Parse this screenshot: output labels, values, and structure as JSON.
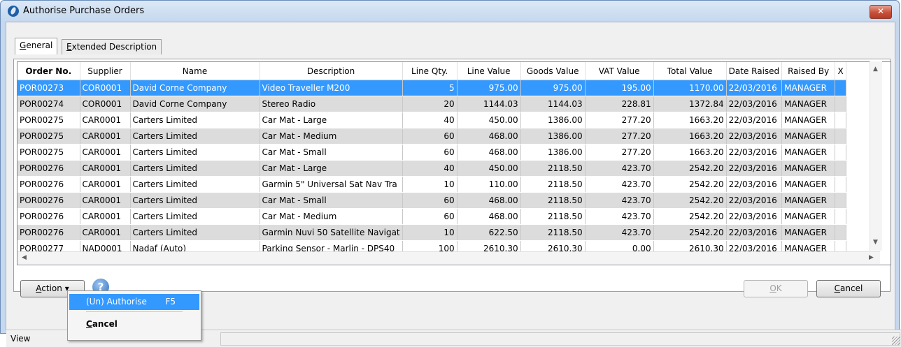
{
  "window": {
    "title": "Authorise Purchase Orders",
    "close_glyph": "✕"
  },
  "tabs": [
    {
      "label": "General",
      "mnemonic": "G",
      "rest": "eneral"
    },
    {
      "label": "Extended Description",
      "mnemonic": "E",
      "rest": "xtended Description"
    }
  ],
  "columns": [
    "Order No.",
    "Supplier",
    "Name",
    "Description",
    "Line Qty.",
    "Line Value",
    "Goods Value",
    "VAT Value",
    "Total Value",
    "Date Raised",
    "Raised By",
    "X"
  ],
  "rows": [
    [
      "POR00273",
      "COR0001",
      "David Corne Company",
      "Video Traveller M200",
      "5",
      "975.00",
      "975.00",
      "195.00",
      "1170.00",
      "22/03/2016",
      "MANAGER"
    ],
    [
      "POR00274",
      "COR0001",
      "David Corne Company",
      "Stereo Radio",
      "20",
      "1144.03",
      "1144.03",
      "228.81",
      "1372.84",
      "22/03/2016",
      "MANAGER"
    ],
    [
      "POR00275",
      "CAR0001",
      "Carters Limited",
      "Car Mat - Large",
      "40",
      "450.00",
      "1386.00",
      "277.20",
      "1663.20",
      "22/03/2016",
      "MANAGER"
    ],
    [
      "POR00275",
      "CAR0001",
      "Carters Limited",
      "Car Mat - Medium",
      "60",
      "468.00",
      "1386.00",
      "277.20",
      "1663.20",
      "22/03/2016",
      "MANAGER"
    ],
    [
      "POR00275",
      "CAR0001",
      "Carters Limited",
      "Car Mat - Small",
      "60",
      "468.00",
      "1386.00",
      "277.20",
      "1663.20",
      "22/03/2016",
      "MANAGER"
    ],
    [
      "POR00276",
      "CAR0001",
      "Carters Limited",
      "Car Mat - Large",
      "40",
      "450.00",
      "2118.50",
      "423.70",
      "2542.20",
      "22/03/2016",
      "MANAGER"
    ],
    [
      "POR00276",
      "CAR0001",
      "Carters Limited",
      "Garmin 5\" Universal Sat Nav Tra",
      "10",
      "110.00",
      "2118.50",
      "423.70",
      "2542.20",
      "22/03/2016",
      "MANAGER"
    ],
    [
      "POR00276",
      "CAR0001",
      "Carters Limited",
      "Car Mat - Small",
      "60",
      "468.00",
      "2118.50",
      "423.70",
      "2542.20",
      "22/03/2016",
      "MANAGER"
    ],
    [
      "POR00276",
      "CAR0001",
      "Carters Limited",
      "Car Mat - Medium",
      "60",
      "468.00",
      "2118.50",
      "423.70",
      "2542.20",
      "22/03/2016",
      "MANAGER"
    ],
    [
      "POR00276",
      "CAR0001",
      "Carters Limited",
      "Garmin Nuvi 50 Satellite Navigat",
      "10",
      "622.50",
      "2118.50",
      "423.70",
      "2542.20",
      "22/03/2016",
      "MANAGER"
    ],
    [
      "POR00277",
      "NAD0001",
      "Nadaf (Auto)",
      "Parking Sensor - Marlin - DPS40",
      "100",
      "2610.30",
      "2610.30",
      "0.00",
      "2610.30",
      "22/03/2016",
      "MANAGER"
    ]
  ],
  "buttons": {
    "action": {
      "label": "Action",
      "mnemonic": "A",
      "rest": "ction",
      "arrow": "▾"
    },
    "ok": {
      "label": "OK",
      "mnemonic": "O",
      "rest": "K"
    },
    "cancel": {
      "label": "Cancel",
      "mnemonic": "C",
      "rest": "ancel"
    },
    "help_glyph": "?"
  },
  "action_menu": {
    "items": [
      {
        "label": "(Un) Authorise",
        "shortcut": "F5"
      },
      {
        "label": "Cancel",
        "mnemonic": "C",
        "rest": "ancel"
      }
    ]
  },
  "status": {
    "text": "View"
  },
  "colors": {
    "selection": "#3399ff",
    "alt_row": "#dcdcdc",
    "title_bg": "#c5d8ee"
  }
}
